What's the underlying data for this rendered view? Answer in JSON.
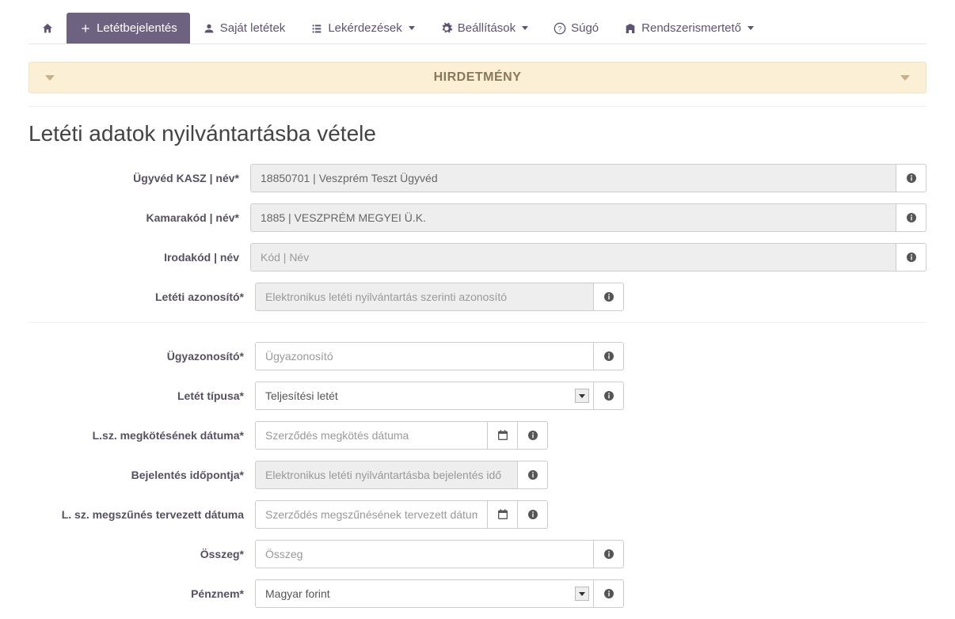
{
  "nav": {
    "letetbejelentes": "Letétbejelentés",
    "sajat_letetek": "Saját letétek",
    "lekerdesek": "Lekérdezések",
    "beallitasok": "Beállítások",
    "sugo": "Súgó",
    "rendszerismerteto": "Rendszerismertető"
  },
  "notice": {
    "title": "HIRDETMÉNY"
  },
  "page_title": "Letéti adatok nyilvántartásba vétele",
  "labels": {
    "ugyved_kasz": "Ügyvéd KASZ | név*",
    "kamarakod": "Kamarakód | név*",
    "irodakod": "Irodakód | név",
    "leteti_azonosito": "Letéti azonosító*",
    "ugyazonosito": "Ügyazonosító*",
    "letet_tipusa": "Letét típusa*",
    "lsz_megkotes": "L.sz. megkötésének dátuma*",
    "bejelentes_ido": "Bejelentés időpontja*",
    "lsz_megszunes": "L. sz. megszűnés tervezett dátuma",
    "osszeg": "Összeg*",
    "penznem": "Pénznem*"
  },
  "values": {
    "ugyved_kasz": "18850701 | Veszprém Teszt Ügyvéd",
    "kamarakod": "1885 | VESZPRÉM MEGYEI Ü.K.",
    "letet_tipusa": "Teljesítési letét",
    "penznem": "Magyar forint"
  },
  "placeholders": {
    "irodakod": "Kód | Név",
    "leteti_azonosito": "Elektronikus letéti nyilvántartás szerinti azonosító",
    "ugyazonosito": "Ügyazonosító",
    "lsz_megkotes": "Szerződés megkötés dátuma",
    "bejelentes_ido": "Elektronikus letéti nyilvántartásba bejelentés idő",
    "lsz_megszunes": "Szerződés megszűnésének tervezett dátum",
    "osszeg": "Összeg"
  }
}
